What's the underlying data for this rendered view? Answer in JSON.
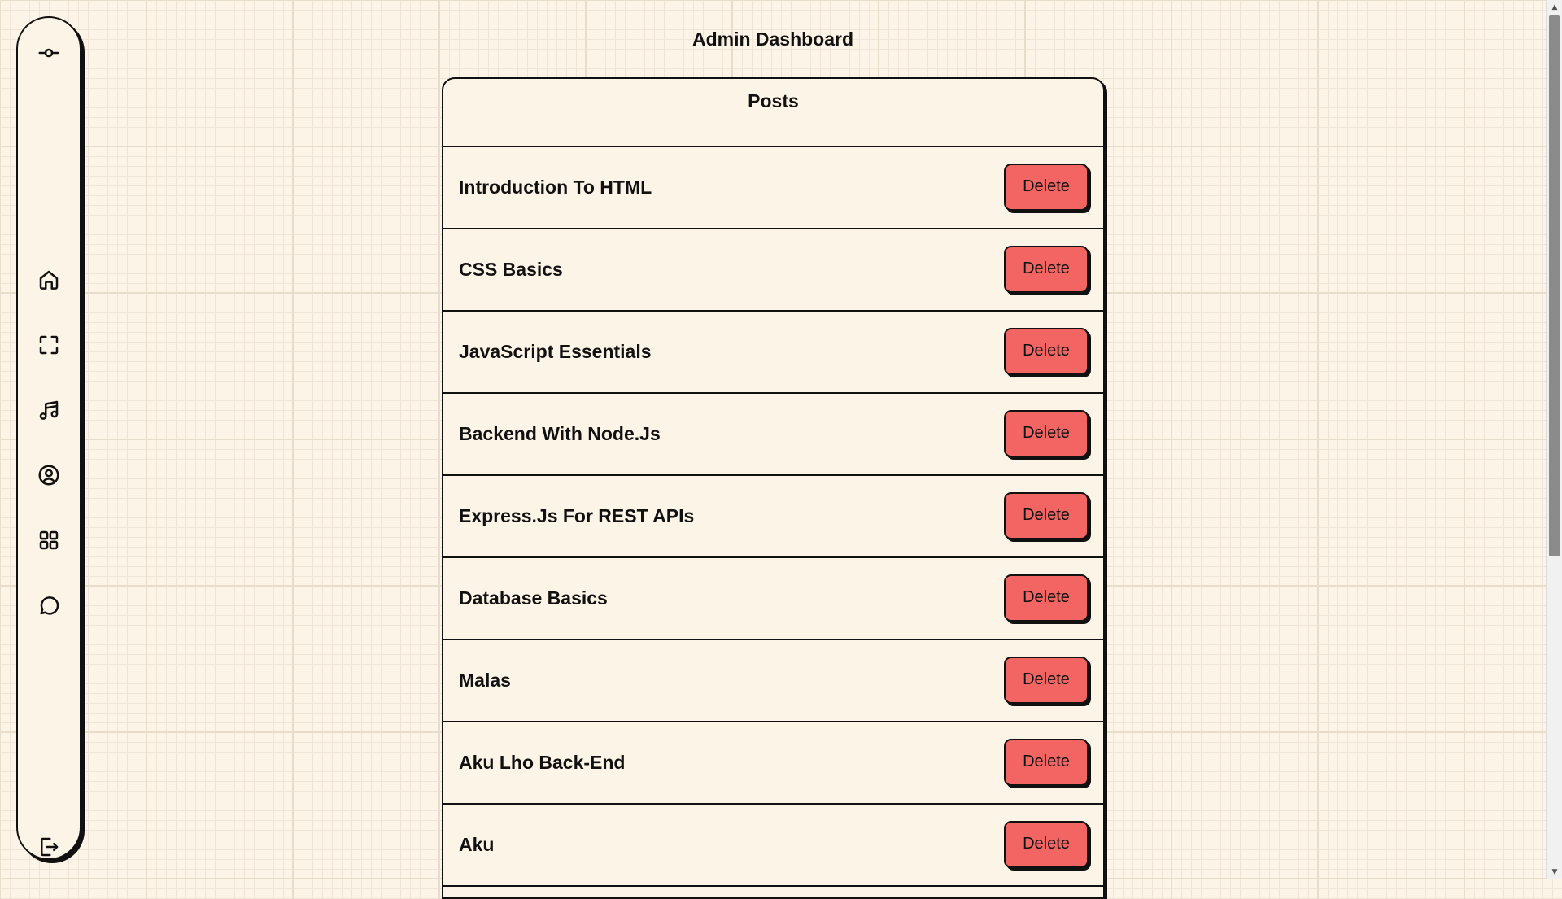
{
  "page": {
    "title": "Admin Dashboard"
  },
  "sidebar": {
    "items": [
      {
        "icon": "commit-icon"
      },
      {
        "icon": "home-icon"
      },
      {
        "icon": "scan-icon"
      },
      {
        "icon": "music-icon"
      },
      {
        "icon": "user-circle-icon"
      },
      {
        "icon": "apps-grid-icon"
      },
      {
        "icon": "chat-bubble-icon"
      },
      {
        "icon": "logout-icon"
      }
    ]
  },
  "panel": {
    "title": "Posts"
  },
  "posts": [
    {
      "title": "Introduction To HTML",
      "action": "Delete"
    },
    {
      "title": "CSS Basics",
      "action": "Delete"
    },
    {
      "title": "JavaScript Essentials",
      "action": "Delete"
    },
    {
      "title": "Backend With Node.Js",
      "action": "Delete"
    },
    {
      "title": "Express.Js For REST APIs",
      "action": "Delete"
    },
    {
      "title": "Database Basics",
      "action": "Delete"
    },
    {
      "title": "Malas",
      "action": "Delete"
    },
    {
      "title": "Aku Lho Back-End",
      "action": "Delete"
    },
    {
      "title": "Aku",
      "action": "Delete"
    }
  ],
  "colors": {
    "background": "#fdf4e8",
    "grid": "#e8dccb",
    "delete_button": "#f26562",
    "border": "#111111"
  }
}
